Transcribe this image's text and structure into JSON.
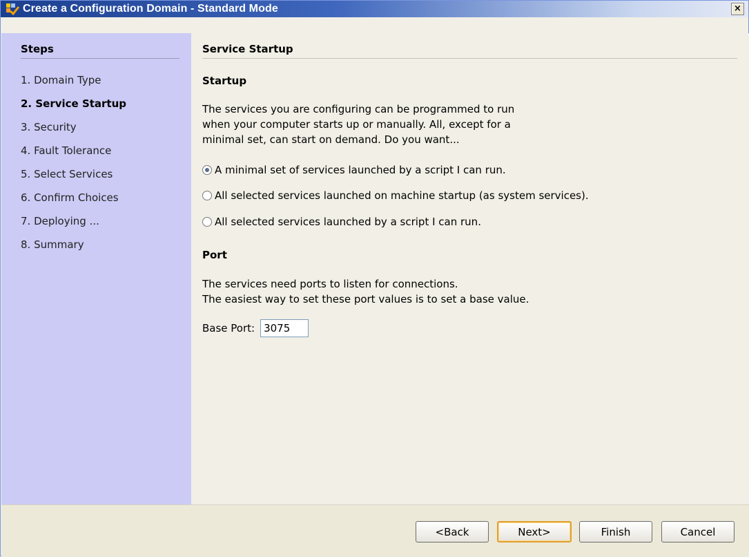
{
  "window": {
    "title": "Create a Configuration Domain - Standard Mode",
    "close_label": "×"
  },
  "steps": {
    "title": "Steps",
    "items": [
      {
        "label": "1. Domain Type",
        "current": false
      },
      {
        "label": "2. Service Startup",
        "current": true
      },
      {
        "label": "3. Security",
        "current": false
      },
      {
        "label": "4. Fault Tolerance",
        "current": false
      },
      {
        "label": "5. Select Services",
        "current": false
      },
      {
        "label": "6. Confirm Choices",
        "current": false
      },
      {
        "label": "7. Deploying ...",
        "current": false
      },
      {
        "label": "8. Summary",
        "current": false
      }
    ]
  },
  "content": {
    "section_title": "Service Startup",
    "startup": {
      "heading": "Startup",
      "para_line1": "The services you are configuring can be programmed to run",
      "para_line2": "when your computer starts up or manually. All, except for a",
      "para_line3": "minimal set, can start on demand. Do you want...",
      "options": [
        {
          "label": "A minimal set of services launched by a script I can run.",
          "checked": true
        },
        {
          "label": "All selected services launched on machine startup (as system services).",
          "checked": false
        },
        {
          "label": "All selected services launched by a script I can run.",
          "checked": false
        }
      ]
    },
    "port": {
      "heading": "Port",
      "para_line1": "The services need ports to listen for connections.",
      "para_line2": "The easiest way to set these port values is to set a base value.",
      "base_port_label": "Base Port:",
      "base_port_value": "3075"
    }
  },
  "buttons": {
    "back": "<Back",
    "next": "Next>",
    "finish": "Finish",
    "cancel": "Cancel"
  },
  "colors": {
    "steps_panel": "#cbcbf5",
    "default_button_border": "#e0a030"
  }
}
